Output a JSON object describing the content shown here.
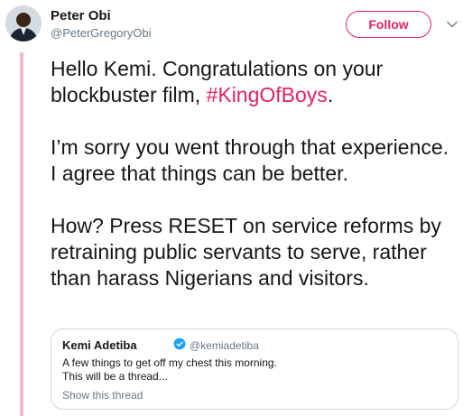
{
  "tweet": {
    "author_name": "Peter Obi",
    "author_handle": "@PeterGregoryObi",
    "follow_label": "Follow",
    "paragraph1_text": "Hello Kemi. Congratulations on your blockbuster film, ",
    "paragraph1_hashtag": "#KingOfBoys",
    "paragraph1_end": ".",
    "paragraph2": "I’m sorry you went through that experience. I agree that things can be better.",
    "paragraph3": "How? Press RESET on service reforms by retraining public servants to serve, rather than harass Nigerians and visitors."
  },
  "quoted": {
    "author_name": "Kemi Adetiba",
    "author_handle": "@kemiadetiba",
    "line1": "A few things to get off my chest this morning.",
    "line2": "This will be a thread...",
    "show_thread": "Show this thread"
  },
  "colors": {
    "accent": "#e0245e",
    "thread_line": "#f5b8c8",
    "secondary_text": "#657786",
    "verified": "#1da1f2"
  },
  "icons": {
    "chevron": "chevron-down-icon",
    "verified": "verified-badge-icon"
  }
}
